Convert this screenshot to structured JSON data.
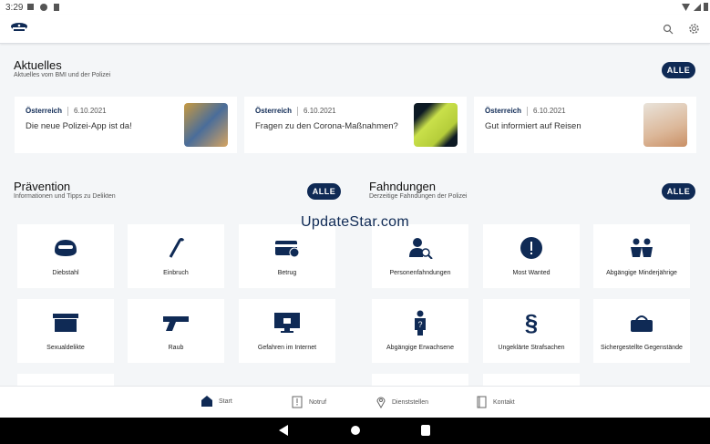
{
  "status": {
    "time": "3:29"
  },
  "colors": {
    "accent": "#0f2a55",
    "background": "#f4f6f8"
  },
  "news": {
    "title": "Aktuelles",
    "subtitle": "Aktuelles vom BMI und der Polizei",
    "all_label": "ALLE",
    "items": [
      {
        "region": "Österreich",
        "date": "6.10.2021",
        "title": "Die neue Polizei-App ist da!"
      },
      {
        "region": "Österreich",
        "date": "6.10.2021",
        "title": "Fragen zu den Corona-Maßnahmen?"
      },
      {
        "region": "Österreich",
        "date": "6.10.2021",
        "title": "Gut informiert auf Reisen"
      }
    ]
  },
  "prevention": {
    "title": "Prävention",
    "subtitle": "Informationen und Tipps zu Delikten",
    "all_label": "ALLE",
    "tiles": [
      {
        "label": "Diebstahl",
        "icon": "mask-icon"
      },
      {
        "label": "Einbruch",
        "icon": "crowbar-icon"
      },
      {
        "label": "Betrug",
        "icon": "card-icon"
      },
      {
        "label": "Sexualdelikte",
        "icon": "box-icon"
      },
      {
        "label": "Raub",
        "icon": "gun-icon"
      },
      {
        "label": "Gefahren im Internet",
        "icon": "monitor-icon"
      }
    ]
  },
  "wanted": {
    "title": "Fahndungen",
    "subtitle": "Derzeitige Fahndungen der Polizei",
    "all_label": "ALLE",
    "tiles": [
      {
        "label": "Personenfahndungen",
        "icon": "person-search-icon"
      },
      {
        "label": "Most Wanted",
        "icon": "exclamation-icon"
      },
      {
        "label": "Abgängige Minderjährige",
        "icon": "children-icon"
      },
      {
        "label": "Abgängige Erwachsene",
        "icon": "person-question-icon"
      },
      {
        "label": "Ungeklärte Strafsachen",
        "icon": "paragraph-icon"
      },
      {
        "label": "Sichergestellte Gegenstände",
        "icon": "bag-icon"
      }
    ]
  },
  "watermark": "UpdateStar.com",
  "bottom_nav": [
    {
      "label": "Start"
    },
    {
      "label": "Notruf"
    },
    {
      "label": "Dienststellen"
    },
    {
      "label": "Kontakt"
    }
  ]
}
